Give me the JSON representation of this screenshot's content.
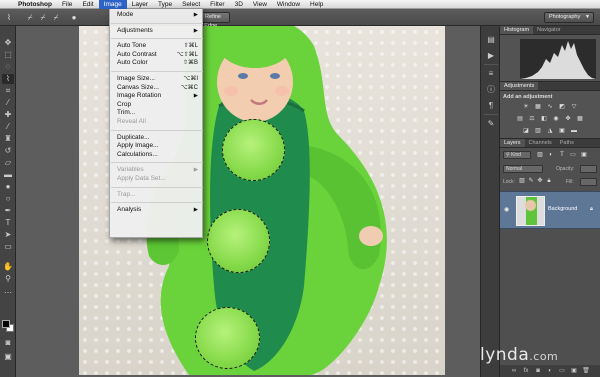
{
  "menubar": {
    "apple_icon": "apple-icon",
    "items": [
      "Photoshop",
      "File",
      "Edit",
      "Image",
      "Layer",
      "Type",
      "Select",
      "Filter",
      "3D",
      "View",
      "Window",
      "Help"
    ],
    "active": "Image"
  },
  "optionsbar": {
    "refine_edge": "Refine Edge...",
    "workspace": "Photography",
    "tool_icons": [
      "quick-selection-icon",
      "new-selection-icon",
      "add-to-selection-icon",
      "subtract-selection-icon",
      "brush-size-icon"
    ]
  },
  "image_menu": {
    "items": [
      {
        "label": "Mode",
        "submenu": true
      },
      {
        "separator": true
      },
      {
        "label": "Adjustments",
        "submenu": true
      },
      {
        "separator": true
      },
      {
        "label": "Auto Tone",
        "shortcut": "⇧⌘L"
      },
      {
        "label": "Auto Contrast",
        "shortcut": "⌥⇧⌘L"
      },
      {
        "label": "Auto Color",
        "shortcut": "⇧⌘B"
      },
      {
        "separator": true
      },
      {
        "label": "Image Size...",
        "shortcut": "⌥⌘I"
      },
      {
        "label": "Canvas Size...",
        "shortcut": "⌥⌘C"
      },
      {
        "label": "Image Rotation",
        "submenu": true
      },
      {
        "label": "Crop"
      },
      {
        "label": "Trim..."
      },
      {
        "label": "Reveal All",
        "disabled": true
      },
      {
        "separator": true
      },
      {
        "label": "Duplicate..."
      },
      {
        "label": "Apply Image..."
      },
      {
        "label": "Calculations..."
      },
      {
        "separator": true
      },
      {
        "label": "Variables",
        "submenu": true,
        "disabled": true
      },
      {
        "label": "Apply Data Set...",
        "disabled": true
      },
      {
        "separator": true
      },
      {
        "label": "Trap...",
        "disabled": true
      },
      {
        "separator": true
      },
      {
        "label": "Analysis",
        "submenu": true
      }
    ]
  },
  "panels": {
    "histogram_tabs": [
      "Histogram",
      "Navigator"
    ],
    "adjustments_tab": "Adjustments",
    "adjustments_title": "Add an adjustment",
    "layers_tabs": [
      "Layers",
      "Channels",
      "Paths"
    ],
    "kind_filter": "Kind",
    "blend_mode": "Normal",
    "opacity_label": "Opacity:",
    "lock_label": "Lock:",
    "fill_label": "Fill:",
    "layer_name": "Background"
  },
  "watermark": {
    "brand": "lynda",
    "suffix": ".com"
  },
  "colors": {
    "menu_highlight": "#2d63c8",
    "pea_green": "#86da4a",
    "layer_selected": "#5e7797"
  }
}
